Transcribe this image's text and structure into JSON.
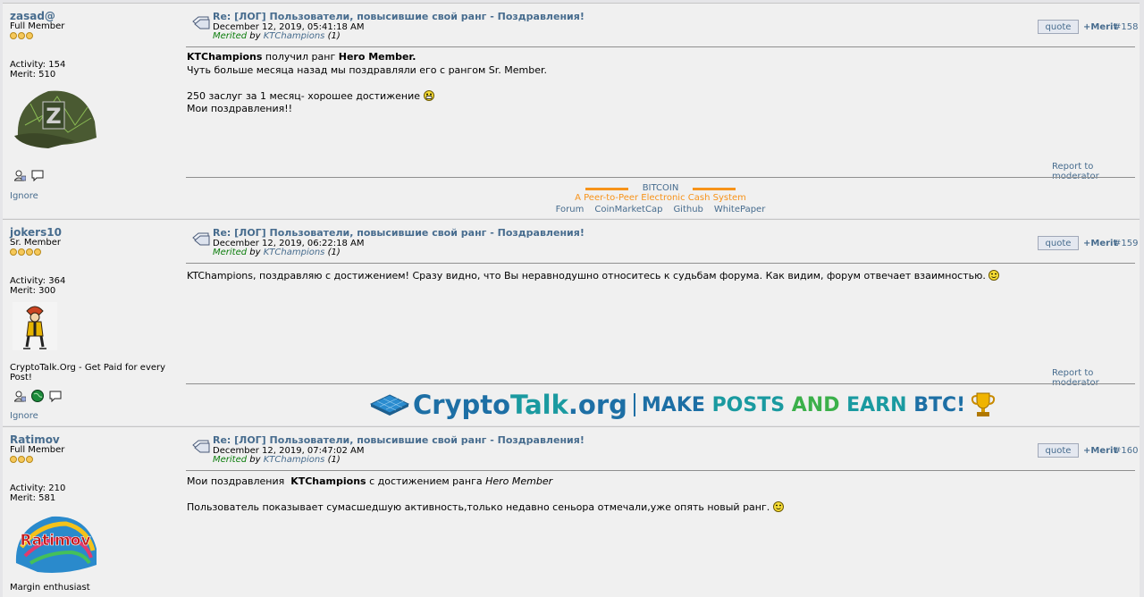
{
  "posts": [
    {
      "username": "zasad@",
      "rank": "Full Member",
      "activity": "Activity: 154",
      "merit": "Merit: 510",
      "signature": "",
      "ignore": "Ignore",
      "subject": "Re: [ЛОГ] Пользователи, повысившие свой ранг - Поздравления!",
      "date": "December 12, 2019, 05:41:18 AM",
      "merited_label": "Merited",
      "merited_by": "by",
      "merited_user": "KTChampions",
      "merited_count": "(1)",
      "quote": "quote",
      "merit_btn": "+Merit",
      "number": "#158",
      "body": {
        "l1_bold1": "KTChampions",
        "l1_mid": " получил ранг ",
        "l1_bold2": "Hero Member.",
        "l2": "Чуть больше месяца назад  мы поздравляли его с рангом Sr. Member.",
        "l3": "250 заслуг за 1 месяц- хорошее достижение",
        "l4": "Мои поздравления!!"
      },
      "report": "Report to moderator"
    },
    {
      "username": "jokers10",
      "rank": "Sr. Member",
      "activity": "Activity: 364",
      "merit": "Merit: 300",
      "signature": "CryptoTalk.Org - Get Paid for every Post!",
      "ignore": "Ignore",
      "subject": "Re: [ЛОГ] Пользователи, повысившие свой ранг - Поздравления!",
      "date": "December 12, 2019, 06:22:18 AM",
      "merited_label": "Merited",
      "merited_by": "by",
      "merited_user": "KTChampions",
      "merited_count": "(1)",
      "quote": "quote",
      "merit_btn": "+Merit",
      "number": "#159",
      "body": {
        "l1": "KTChampions, поздравляю с достижением! Сразу видно, что Вы неравнодушно относитесь к судьбам форума. Как видим, форум отвечает взаимностью."
      },
      "report": "Report to moderator"
    },
    {
      "username": "Ratimov",
      "rank": "Full Member",
      "activity": "Activity: 210",
      "merit": "Merit: 581",
      "signature": "Margin enthusiast",
      "subject": "Re: [ЛОГ] Пользователи, повысившие свой ранг - Поздравления!",
      "date": "December 12, 2019, 07:47:02 AM",
      "merited_label": "Merited",
      "merited_by": "by",
      "merited_user": "KTChampions",
      "merited_count": "(1)",
      "quote": "quote",
      "merit_btn": "+Merit",
      "number": "#160",
      "body": {
        "l1_pre": "Мои поздравления  ",
        "l1_bold": "KTChampions",
        "l1_mid": " с достижением ранга ",
        "l1_ital": "Hero Member",
        "l2": "Пользователь показывает сумасшедшую активность,только недавно сеньора отмечали,уже опять новый ранг."
      }
    }
  ],
  "ads": {
    "bitcoin": {
      "title": "BITCOIN",
      "subtitle": "A Peer-to-Peer Electronic Cash System",
      "links": [
        "Forum",
        "CoinMarketCap",
        "Github",
        "WhitePaper"
      ]
    },
    "cryptotalk": {
      "crypto": "Crypto",
      "talk": "Talk",
      "org": ".org",
      "make": "MAKE ",
      "posts": "POSTS ",
      "and": "AND ",
      "earn": "EARN ",
      "btc": "BTC!"
    }
  },
  "colors": {
    "link": "#476c8e",
    "merited": "#0a7c0a",
    "bitcoin_orange": "#f7931a",
    "cryptotalk_blue": "#1d6fa5",
    "cryptotalk_teal": "#1a9aa0",
    "cryptotalk_green": "#3bb04a"
  }
}
